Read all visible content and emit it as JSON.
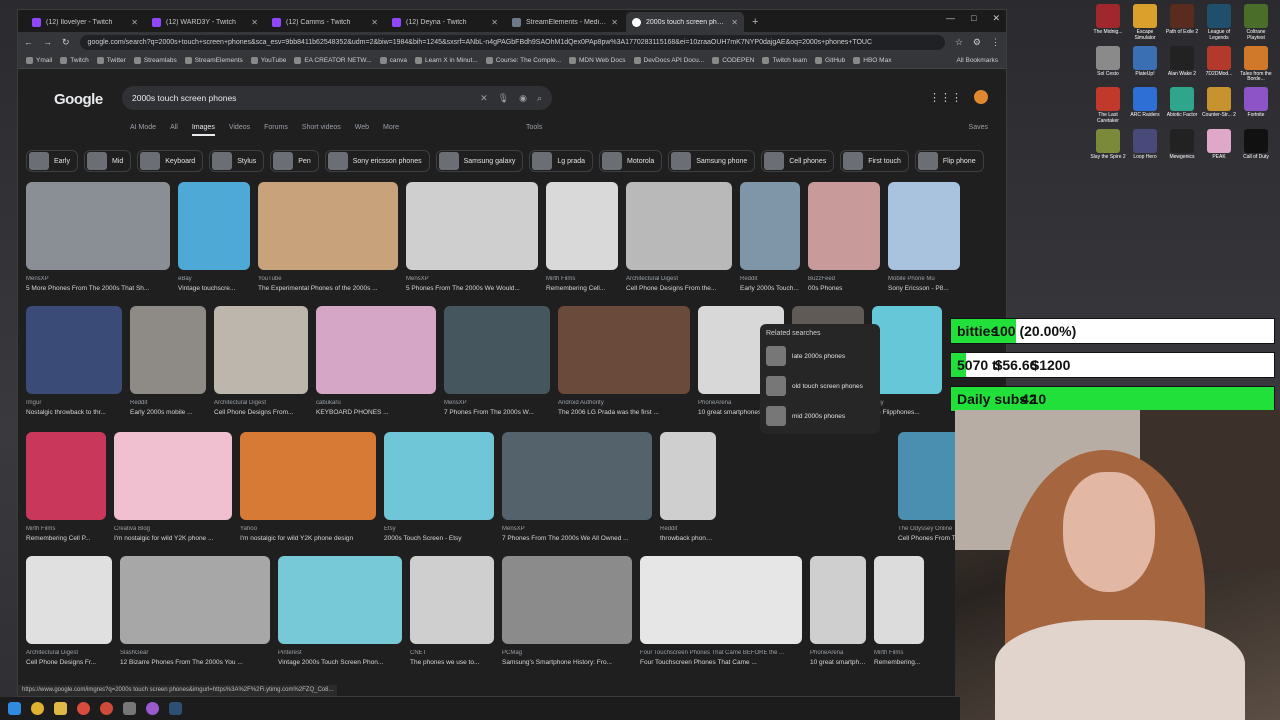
{
  "browser": {
    "tabs": [
      {
        "title": "(12) Ilovelyer - Twitch",
        "type": "twitch"
      },
      {
        "title": "(12) WARD3Y - Twitch",
        "type": "twitch"
      },
      {
        "title": "(12) Camms - Twitch",
        "type": "twitch"
      },
      {
        "title": "(12) Deyna - Twitch",
        "type": "twitch"
      },
      {
        "title": "StreamElements - Media r",
        "type": "se"
      },
      {
        "title": "2000s touch screen phones - G",
        "type": "google",
        "active": true
      }
    ],
    "url": "google.com/search?q=2000s+touch+screen+phones&sca_esv=9bb8411b62548352&udm=2&biw=1984&bih=1245&sxsrf=ANbL-n4gPAGbFBdh9SAOhM1dQex0PAp8pw%3A1770283115168&ei=10zraaOUH7mK7NYP0dajgAE&oq=2000s+phones+TOUC",
    "bookmarks": [
      "Ymail",
      "Twitch",
      "Twitter",
      "Streamlabs",
      "StreamElements",
      "YouTube",
      "EA CREATOR NETW...",
      "canva",
      "Learn X in Minut...",
      "Course: The Comple...",
      "MDN Web Docs",
      "DevDocs API Docu...",
      "CODEPEN",
      "Twitch team",
      "GitHub",
      "HBO Max"
    ],
    "all_bookmarks": "All Bookmarks",
    "status_url": "https://www.google.com/imgres?q=2000s touch screen phones&imgurl=https%3A%2F%2Fi.ytimg.com%2FZQ_Co8..."
  },
  "google": {
    "logo": "Google",
    "query": "2000s touch screen phones",
    "nav": [
      "AI Mode",
      "All",
      "Images",
      "Videos",
      "Forums",
      "Short videos",
      "Web",
      "More"
    ],
    "tools": "Tools",
    "saves": "Saves",
    "chips": [
      "Early",
      "Mid",
      "Keyboard",
      "Stylus",
      "Pen",
      "Sony ericsson phones",
      "Samsung galaxy",
      "Lg prada",
      "Motorola",
      "Samsung phone",
      "Cell phones",
      "First touch",
      "Flip phone"
    ],
    "related": {
      "heading": "Related searches",
      "items": [
        "late 2000s phones",
        "old touch screen phones",
        "mid 2000s phones"
      ]
    },
    "rows": [
      [
        {
          "src": "MensXP",
          "cap": "5 More Phones From The 2000s That Sh...",
          "color": "#8a8f96"
        },
        {
          "src": "eBay",
          "cap": "Vintage touchscre...",
          "color": "#4fa9d6"
        },
        {
          "src": "YouTube",
          "cap": "The Experimental Phones of the 2000s ...",
          "color": "#c8a27a"
        },
        {
          "src": "MensXP",
          "cap": "5 Phones From The 2000s We Would...",
          "color": "#cfcfcf"
        },
        {
          "src": "Mirth Films",
          "cap": "Remembering Cell...",
          "color": "#d9d9d9"
        },
        {
          "src": "Architectural Digest",
          "cap": "Cell Phone Designs From the...",
          "color": "#b9b9b9"
        },
        {
          "src": "Reddit",
          "cap": "Early 2000s Touch...",
          "color": "#7f96a8"
        },
        {
          "src": "BuzzFeed",
          "cap": "00s Phones",
          "color": "#c99a9a"
        },
        {
          "src": "Mobile Phone Mu",
          "cap": "Sony Ericsson - P8...",
          "color": "#a9c3df"
        }
      ],
      [
        {
          "src": "Imgur",
          "cap": "Nostalgic throwback to thr...",
          "color": "#3b4b78"
        },
        {
          "src": "Reddit",
          "cap": "Early 2000s mobile ...",
          "color": "#8e8a86"
        },
        {
          "src": "Architectural Digest",
          "cap": "Cell Phone Designs From...",
          "color": "#bdb6ad"
        },
        {
          "src": "cabukaru",
          "cap": "KEYBOARD PHONES ...",
          "color": "#d6a6c7"
        },
        {
          "src": "MensXP",
          "cap": "7 Phones From The 2000s W...",
          "color": "#46565f"
        },
        {
          "src": "Android Authority",
          "cap": "The 2006 LG Prada was the first ...",
          "color": "#6a4b3b"
        },
        {
          "src": "PhoneArena",
          "cap": "10 great smartphones ...",
          "color": "#d8d8d8"
        },
        {
          "src": "TikTok",
          "cap": "Verizon Cell Phone...",
          "color": "#5f5a55"
        },
        {
          "src": "Etsy",
          "cap": "LG Flipphones...",
          "color": "#66c7d9"
        }
      ],
      [
        {
          "src": "Mirth Films",
          "cap": "Remembering Cell P...",
          "color": "#c9375a"
        },
        {
          "src": "Creativa Blog",
          "cap": "I'm nostalgic for wild Y2K phone ...",
          "color": "#f0bfd0"
        },
        {
          "src": "Yahoo",
          "cap": "I'm nostalgic for wild Y2K phone design",
          "color": "#d77a35"
        },
        {
          "src": "Etsy",
          "cap": "2000s Touch Screen - Etsy",
          "color": "#6fc6d6"
        },
        {
          "src": "MensXP",
          "cap": "7 Phones From The 2000s We All Owned ...",
          "color": "#53626b"
        },
        {
          "src": "Reddit",
          "cap": "throwback phones ...",
          "color": "#cfcfcf"
        },
        {
          "src": "The Odyssey Online",
          "cap": "Cell Phones From T...",
          "color": "#4b8fb0"
        }
      ],
      [
        {
          "src": "Architectural Digest",
          "cap": "Cell Phone Designs Fr...",
          "color": "#e0e0e0"
        },
        {
          "src": "SlashGear",
          "cap": "12 Bizarre Phones From The 2000s You ...",
          "color": "#a7a7a7"
        },
        {
          "src": "Pinterest",
          "cap": "Vintage 2000s Touch Screen Phon...",
          "color": "#78c9d8"
        },
        {
          "src": "CNET",
          "cap": "The phones we use to...",
          "color": "#cfcfcf"
        },
        {
          "src": "PCMag",
          "cap": "Samsung's Smartphone History: Fro...",
          "color": "#8b8b8b"
        },
        {
          "src": "Four Touchscreen Phones That Came BEFORE the ...",
          "cap": "Four Touchscreen Phones That Came ...",
          "color": "#e6e6e6"
        },
        {
          "src": "PhoneArena",
          "cap": "10 great smartpho...",
          "color": "#cfcfcf"
        },
        {
          "src": "Mirth Films",
          "cap": "Remembering...",
          "color": "#dcdcdc"
        }
      ]
    ]
  },
  "desktop_icons": [
    {
      "label": "The Midnig...",
      "color": "#a0282c"
    },
    {
      "label": "Escape Simulator",
      "color": "#d9a12b"
    },
    {
      "label": "Path of Exile 2",
      "color": "#5a2b1f"
    },
    {
      "label": "League of Legends",
      "color": "#1f4f6a"
    },
    {
      "label": "Coltrane Playtest",
      "color": "#4a6d2a"
    },
    {
      "label": "Sol Cesto",
      "color": "#8a8a8a"
    },
    {
      "label": "PlateUp!",
      "color": "#3b6fb3"
    },
    {
      "label": "Alan Wake 2",
      "color": "#222222"
    },
    {
      "label": "7D2DMod...",
      "color": "#b33a2a"
    },
    {
      "label": "Tales from the Borde...",
      "color": "#d1792b"
    },
    {
      "label": "The Last Caretaker",
      "color": "#c0392b"
    },
    {
      "label": "ARC Raiders",
      "color": "#2e6fd6"
    },
    {
      "label": "Abiotic Factor",
      "color": "#2fa58c"
    },
    {
      "label": "Counter-Str... 2",
      "color": "#c6932e"
    },
    {
      "label": "Fortnite",
      "color": "#8c54c7"
    },
    {
      "label": "Slay the Spire 2",
      "color": "#7b8a3a"
    },
    {
      "label": "Loop Hero",
      "color": "#4a4a7a"
    },
    {
      "label": "Mewgenics",
      "color": "#222222"
    },
    {
      "label": "PEAK",
      "color": "#e0a8c8"
    },
    {
      "label": "Call of Duty",
      "color": "#111111"
    }
  ],
  "overlay": {
    "bitties": {
      "label": "bitties",
      "value": "100 (20.00%)",
      "progress": 0.2
    },
    "gpu": {
      "label": "5070 ti",
      "current": "$56.66",
      "goal": "$1200",
      "progress": 0.047
    },
    "subs": {
      "label": "Daily subs",
      "current": "42",
      "goal": "10",
      "progress": 1.0
    }
  },
  "colors": {
    "accent": "#22e03a",
    "google_bg": "#1f1f1f"
  }
}
